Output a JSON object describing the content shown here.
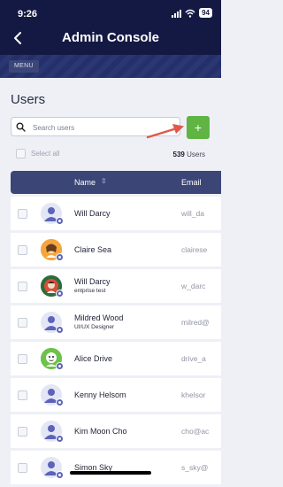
{
  "status": {
    "time": "9:26",
    "battery": "94"
  },
  "header": {
    "title": "Admin Console",
    "menu_label": "MENU"
  },
  "users": {
    "section_title": "Users",
    "search": {
      "placeholder": "Search users",
      "value": ""
    },
    "add_label": "+",
    "select_all_label": "Select all",
    "count": "539",
    "count_suffix": "Users",
    "columns": {
      "name": "Name",
      "email": "Email"
    },
    "rows": [
      {
        "name": "Will Darcy",
        "subtitle": "",
        "email": "will_da",
        "avatar": "default"
      },
      {
        "name": "Claire Sea",
        "subtitle": "",
        "email": "clairese",
        "avatar": "photo"
      },
      {
        "name": "Will Darcy",
        "subtitle": "entprise test",
        "email": "w_darc",
        "avatar": "photo"
      },
      {
        "name": "Mildred Wood",
        "subtitle": "UI/UX Designer",
        "email": "milred@",
        "avatar": "default"
      },
      {
        "name": "Alice Drive",
        "subtitle": "",
        "email": "drive_a",
        "avatar": "photo"
      },
      {
        "name": "Kenny Helsom",
        "subtitle": "",
        "email": "khelsor",
        "avatar": "default"
      },
      {
        "name": "Kim Moon Cho",
        "subtitle": "",
        "email": "cho@ac",
        "avatar": "default"
      },
      {
        "name": "Simon Sky",
        "subtitle": "",
        "email": "s_sky@",
        "avatar": "default"
      }
    ]
  },
  "colors": {
    "header": "#141943",
    "accent": "#5fb443",
    "table_header": "#3b4576",
    "arrow": "#e0584a"
  }
}
